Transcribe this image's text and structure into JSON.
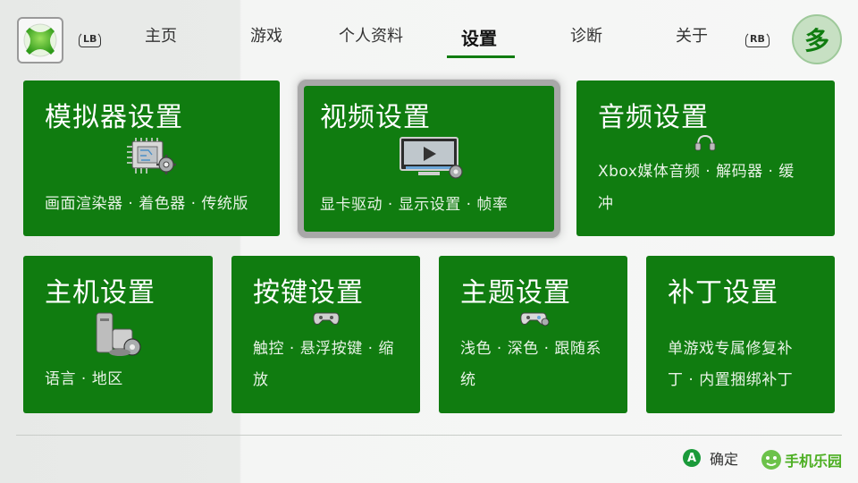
{
  "header": {
    "bumper_left": "LB",
    "bumper_right": "RB",
    "tabs": [
      {
        "label": "主页"
      },
      {
        "label": "游戏"
      },
      {
        "label": "个人资料"
      },
      {
        "label": "设置"
      },
      {
        "label": "诊断"
      },
      {
        "label": "关于"
      }
    ],
    "active_tab": "设置",
    "avatar_text": "多",
    "logo_icon": "xbox-logo-icon"
  },
  "tiles": [
    {
      "title": "模拟器设置",
      "desc": "画面渲染器 · 着色器 · 传统版",
      "icon": "chip-gear-icon"
    },
    {
      "title": "视频设置",
      "desc": "显卡驱动 · 显示设置 · 帧率",
      "icon": "monitor-play-icon"
    },
    {
      "title": "音频设置",
      "desc_lines": [
        "Xbox媒体音频 · 解码器 · 缓",
        "冲"
      ],
      "icon": "headphones-icon"
    },
    {
      "title": "主机设置",
      "desc": "语言 · 地区",
      "icon": "console-gear-icon"
    },
    {
      "title": "按键设置",
      "desc_lines": [
        "触控 · 悬浮按键 · 缩",
        "放"
      ],
      "icon": "gamepad-icon"
    },
    {
      "title": "主题设置",
      "desc_lines": [
        "浅色 · 深色 · 跟随系",
        "统"
      ],
      "icon": "theme-gamepad-icon"
    },
    {
      "title": "补丁设置",
      "desc_lines": [
        "单游戏专属修复补",
        "丁 · 内置捆绑补丁"
      ],
      "icon": "patch-icon"
    }
  ],
  "footer": {
    "a_label": "A",
    "confirm_label": "确定",
    "watermark": "手机乐园"
  },
  "colors": {
    "tile_green": "#107c10",
    "accent": "#107c10"
  }
}
